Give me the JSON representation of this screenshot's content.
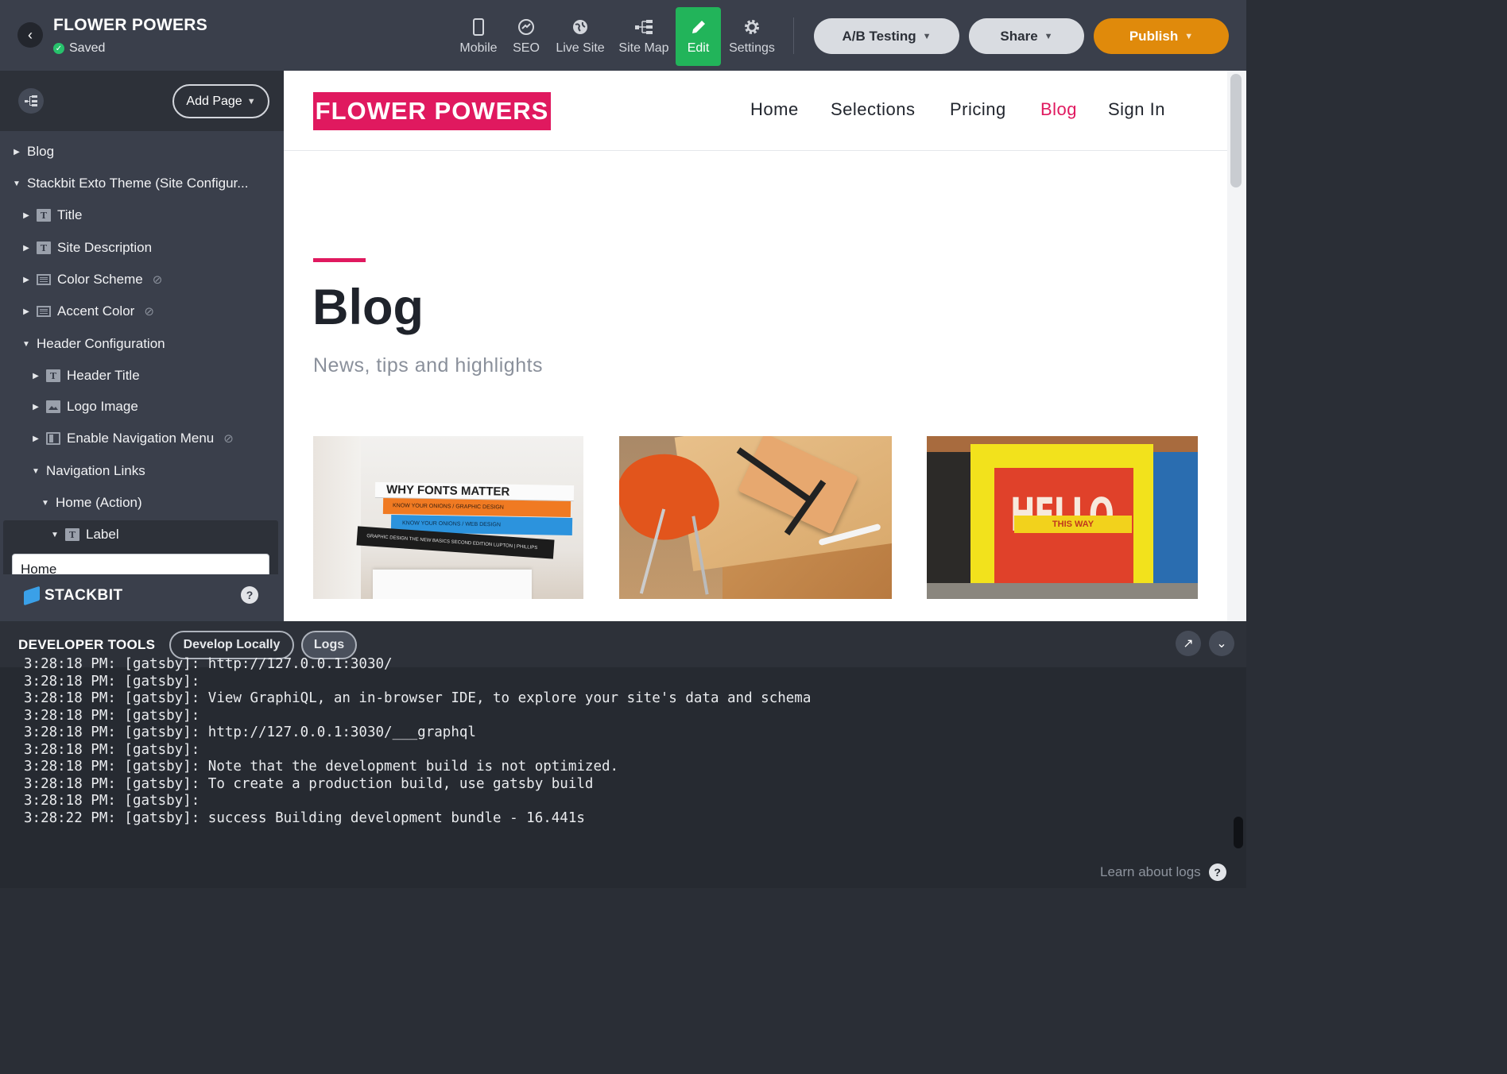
{
  "app": {
    "title": "FLOWER POWERS",
    "status": "Saved"
  },
  "toolbar": {
    "mobile": "Mobile",
    "seo": "SEO",
    "live_site": "Live Site",
    "site_map": "Site Map",
    "edit": "Edit",
    "settings": "Settings",
    "ab_testing": "A/B Testing",
    "share": "Share",
    "publish": "Publish"
  },
  "sidebar": {
    "add_page": "Add Page",
    "tree": [
      {
        "label": "Blog"
      },
      {
        "label": "Stackbit Exto Theme (Site Configur..."
      },
      {
        "label": "Title"
      },
      {
        "label": "Site Description"
      },
      {
        "label": "Color Scheme"
      },
      {
        "label": "Accent Color"
      },
      {
        "label": "Header Configuration"
      },
      {
        "label": "Header Title"
      },
      {
        "label": "Logo Image"
      },
      {
        "label": "Enable Navigation Menu"
      },
      {
        "label": "Navigation Links"
      },
      {
        "label": "Home (Action)"
      },
      {
        "label": "Label"
      }
    ],
    "label_value": "Home",
    "brand": "STACKBIT"
  },
  "preview": {
    "logo": "FLOWER POWERS",
    "nav": [
      "Home",
      "Selections",
      "Pricing",
      "Blog",
      "Sign In"
    ],
    "heading": "Blog",
    "subheading": "News, tips and highlights",
    "thumb1": {
      "title": "WHY FONTS MATTER",
      "book2": "KNOW YOUR ONIONS / GRAPHIC DESIGN",
      "book3": "KNOW YOUR ONIONS / WEB DESIGN",
      "book4": "GRAPHIC DESIGN THE NEW BASICS   SECOND EDITION   LUPTON | PHILLIPS"
    },
    "thumb3": {
      "word": "HELLO",
      "banner": "THIS WAY"
    }
  },
  "devtools": {
    "title": "DEVELOPER TOOLS",
    "tabs": [
      "Develop Locally",
      "Logs"
    ],
    "logs": "3:28:18 PM: [gatsby]: http://127.0.0.1:3030/\n3:28:18 PM: [gatsby]:\n3:28:18 PM: [gatsby]: View GraphiQL, an in-browser IDE, to explore your site's data and schema\n3:28:18 PM: [gatsby]:\n3:28:18 PM: [gatsby]: http://127.0.0.1:3030/___graphql\n3:28:18 PM: [gatsby]:\n3:28:18 PM: [gatsby]: Note that the development build is not optimized.\n3:28:18 PM: [gatsby]: To create a production build, use gatsby build\n3:28:18 PM: [gatsby]:\n3:28:22 PM: [gatsby]: success Building development bundle - 16.441s",
    "learn": "Learn about logs"
  },
  "colors": {
    "accent": "#e0195f",
    "edit_active": "#22b45a",
    "publish": "#e08a0b"
  }
}
